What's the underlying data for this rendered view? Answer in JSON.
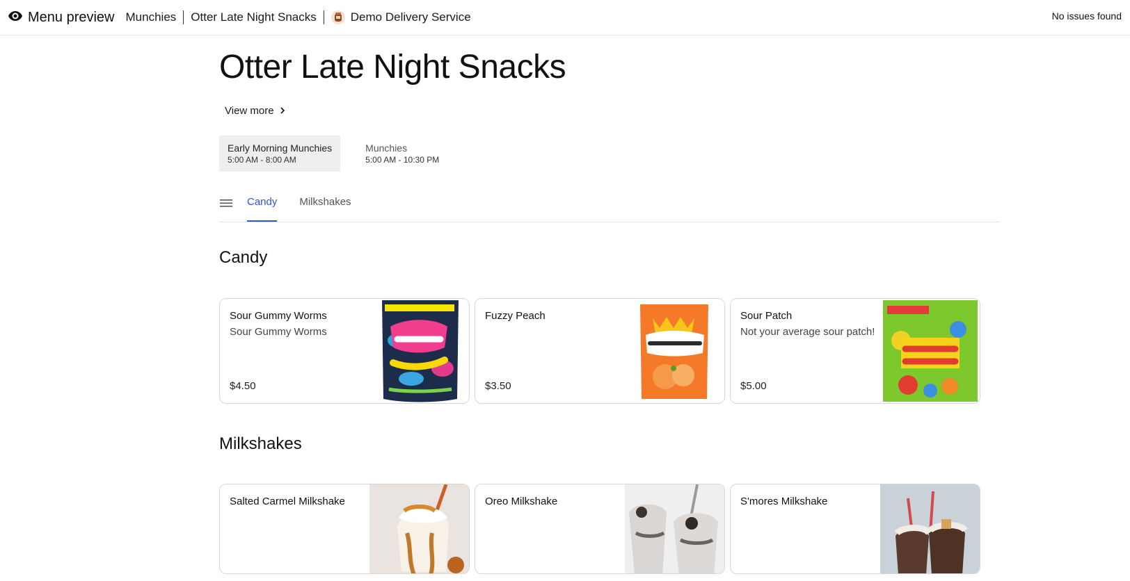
{
  "header": {
    "title": "Menu preview",
    "breadcrumb": [
      "Munchies",
      "Otter Late Night Snacks",
      "Demo Delivery Service"
    ],
    "status": "No issues found"
  },
  "store": {
    "name": "Otter Late Night Snacks",
    "view_more": "View more"
  },
  "menus": [
    {
      "name": "Early Morning Munchies",
      "hours": "5:00 AM - 8:00 AM"
    },
    {
      "name": "Munchies",
      "hours": "5:00 AM - 10:30 PM"
    }
  ],
  "tabs": [
    "Candy",
    "Milkshakes"
  ],
  "sections": [
    {
      "title": "Candy",
      "items": [
        {
          "name": "Sour Gummy Worms",
          "description": "Sour Gummy Worms",
          "price": "$4.50",
          "image": "trolli-bag"
        },
        {
          "name": "Fuzzy Peach",
          "description": "",
          "price": "$3.50",
          "image": "maynards-bag"
        },
        {
          "name": "Sour Patch",
          "description": "Not your average sour patch!",
          "price": "$5.00",
          "image": "sour-patch-bag"
        }
      ]
    },
    {
      "title": "Milkshakes",
      "items": [
        {
          "name": "Salted Carmel Milkshake",
          "description": "",
          "price": "",
          "image": "caramel-milkshake"
        },
        {
          "name": "Oreo Milkshake",
          "description": "",
          "price": "",
          "image": "oreo-milkshake"
        },
        {
          "name": "S'mores Milkshake",
          "description": "",
          "price": "",
          "image": "smores-milkshake"
        }
      ]
    }
  ],
  "colors": {
    "accent": "#2b59d4",
    "active_menu_bg": "#eeeeee",
    "border": "#d6d6d6"
  }
}
